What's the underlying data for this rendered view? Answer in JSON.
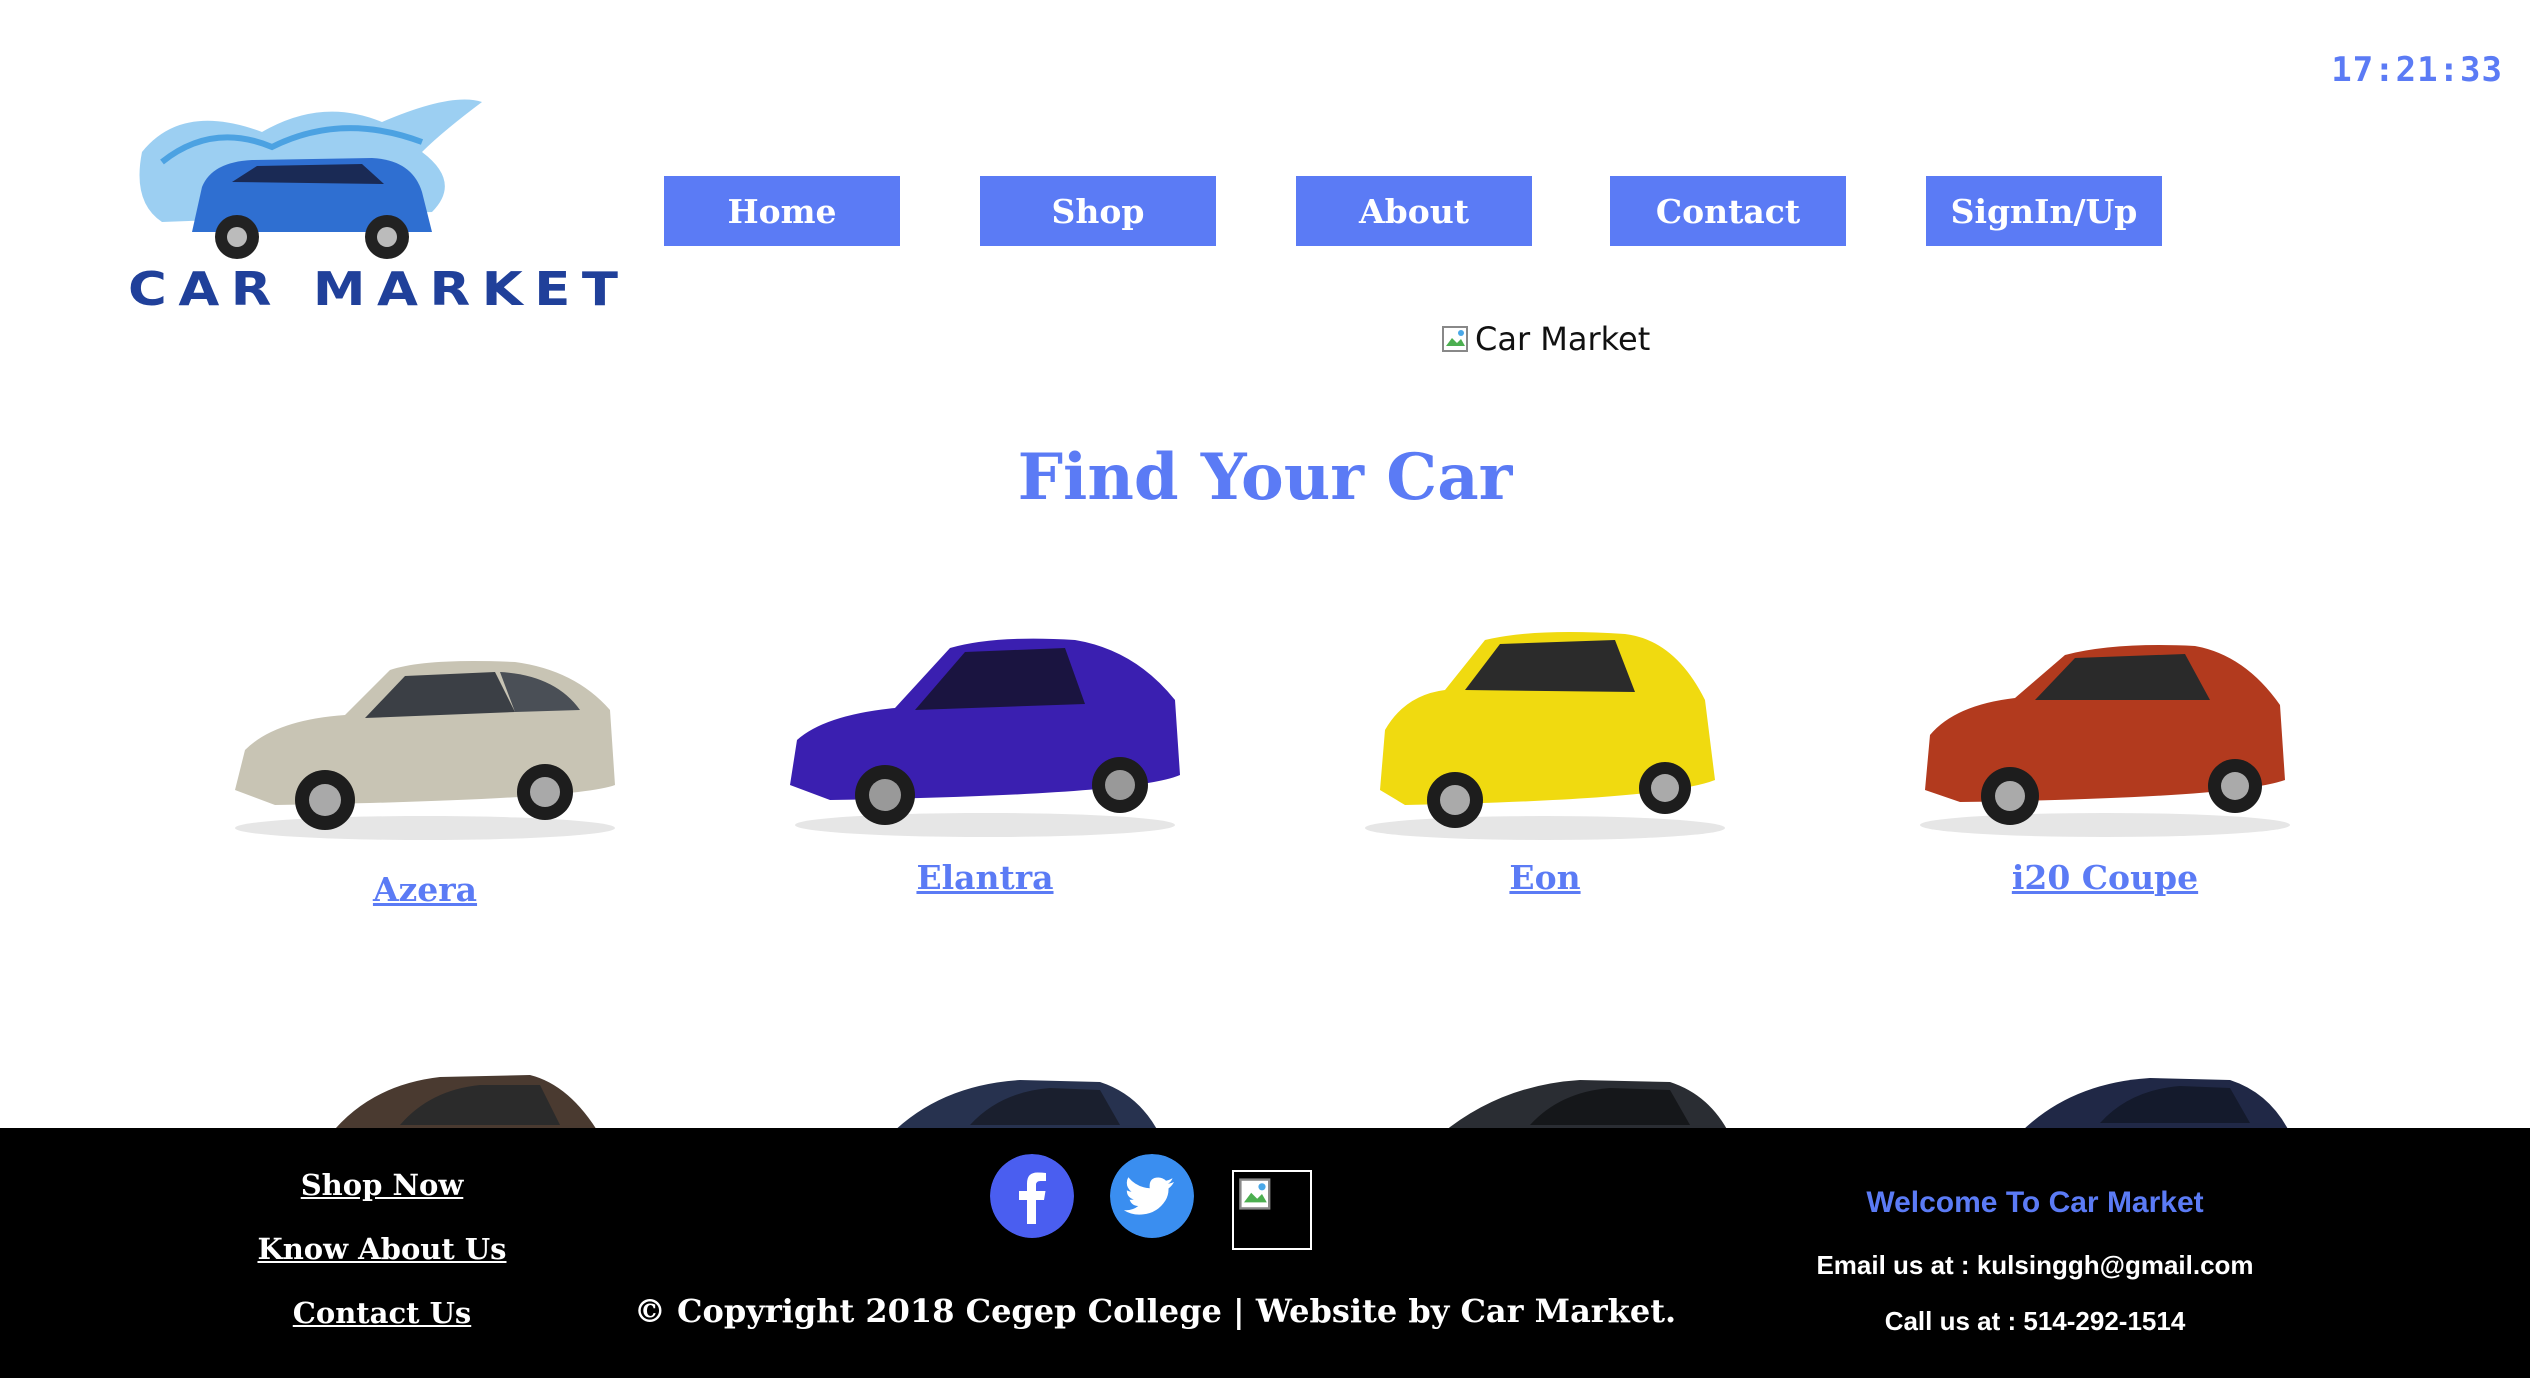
{
  "clock": "17:21:33",
  "logo": {
    "text": "CAR MARKET"
  },
  "nav": [
    {
      "label": "Home"
    },
    {
      "label": "Shop"
    },
    {
      "label": "About"
    },
    {
      "label": "Contact"
    },
    {
      "label": "SignIn/Up"
    }
  ],
  "banner": {
    "alt_text": "Car Market"
  },
  "heading": "Find Your Car",
  "cars": [
    {
      "name": "Azera",
      "color": "#c8c4b4"
    },
    {
      "name": "Elantra",
      "color": "#3a1fb0"
    },
    {
      "name": "Eon",
      "color": "#f0da10"
    },
    {
      "name": "i20 Coupe",
      "color": "#b23a1e"
    }
  ],
  "footer": {
    "links": [
      {
        "label": "Shop Now"
      },
      {
        "label": "Know About Us"
      },
      {
        "label": "Contact Us"
      }
    ],
    "social": [
      "facebook-icon",
      "twitter-icon"
    ],
    "copyright": "© Copyright 2018 Cegep College | Website by Car Market.",
    "welcome": "Welcome To Car Market",
    "email": "Email us at : kulsinggh@gmail.com",
    "phone": "Call us at : 514-292-1514"
  },
  "colors": {
    "accent": "#5b7bf5",
    "footer_bg": "#000000"
  }
}
